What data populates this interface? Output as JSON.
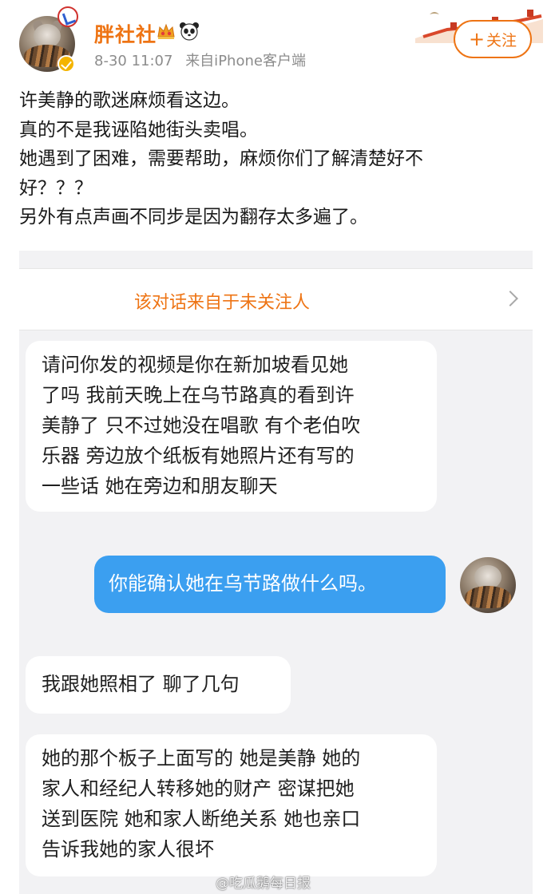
{
  "post": {
    "username": "胖社社",
    "meta_time": "8-30 11:07",
    "meta_source": "来自iPhone客户端",
    "follow_label": "关注",
    "follow_plus": "+",
    "lines": [
      "许美静的歌迷麻烦看这边。",
      "真的不是我诬陷她街头卖唱。",
      "她遇到了困难，需要帮助，麻烦你们了解清楚好不",
      "好？？？",
      "另外有点声画不同步是因为翻存太多遍了。"
    ]
  },
  "chat": {
    "notice": "该对话来自于未关注人",
    "messages": [
      {
        "side": "in",
        "lines": [
          "请问你发的视频是你在新加坡看见她",
          "了吗 我前天晚上在乌节路真的看到许",
          "美静了 只不过她没在唱歌 有个老伯吹",
          "乐器 旁边放个纸板有她照片还有写的",
          "一些话 她在旁边和朋友聊天"
        ]
      },
      {
        "side": "out",
        "lines": [
          "你能确认她在乌节路做什么吗。"
        ]
      },
      {
        "side": "in",
        "lines": [
          "我跟她照相了 聊了几句"
        ]
      },
      {
        "side": "in",
        "lines": [
          "她的那个板子上面写的 她是美静 她的",
          "家人和经纪人转移她的财产 密谋把她",
          "送到医院 她和家人断绝关系 她也亲口",
          "告诉我她的家人很坏"
        ]
      }
    ]
  },
  "watermark": "@吃瓜鹅每日报",
  "colors": {
    "accent_orange": "#ee7414",
    "bubble_blue": "#3b9ff0",
    "chat_bg": "#f2f2f4"
  },
  "icons": [
    "crown-icon",
    "panda-icon",
    "verified-badge-icon",
    "chevron-right-icon",
    "great-wall-banner-icon"
  ]
}
